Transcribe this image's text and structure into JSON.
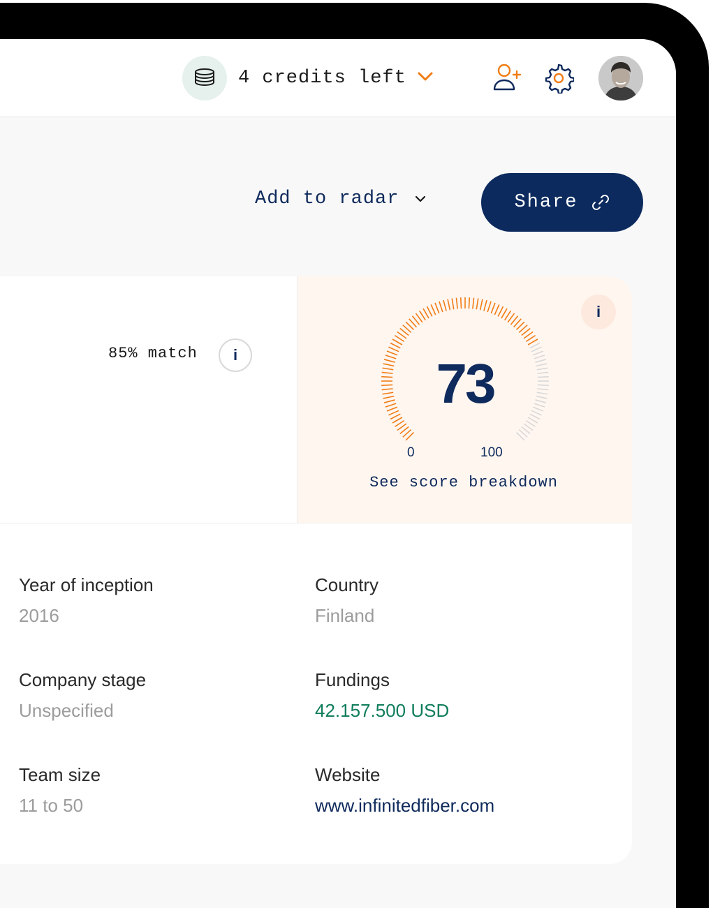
{
  "topbar": {
    "credits_label": "4 credits left",
    "icons": [
      "coins-stack-icon",
      "chevron-down-icon",
      "add-user-icon",
      "gear-icon",
      "avatar"
    ]
  },
  "actions": {
    "add_to_radar": "Add to radar",
    "share": "Share"
  },
  "match": {
    "label": "85% match",
    "info": "i"
  },
  "score": {
    "info": "i",
    "value": "73",
    "min": "0",
    "max": "100",
    "fraction": 0.73,
    "breakdown_link": "See score breakdown"
  },
  "fields": [
    {
      "label": "Year of inception",
      "value": "2016"
    },
    {
      "label": "Country",
      "value": "Finland"
    },
    {
      "label": "Company stage",
      "value": "Unspecified"
    },
    {
      "label": "Fundings",
      "value": "42.157.500 USD"
    },
    {
      "label": "Team size",
      "value": "11 to 50"
    },
    {
      "label": "Website",
      "value": "www.infinitedfiber.com"
    }
  ],
  "colors": {
    "navy": "#0c2a5e",
    "orange": "#f07d16",
    "green": "#0f7d5c",
    "score_bg": "#fff6f0"
  }
}
